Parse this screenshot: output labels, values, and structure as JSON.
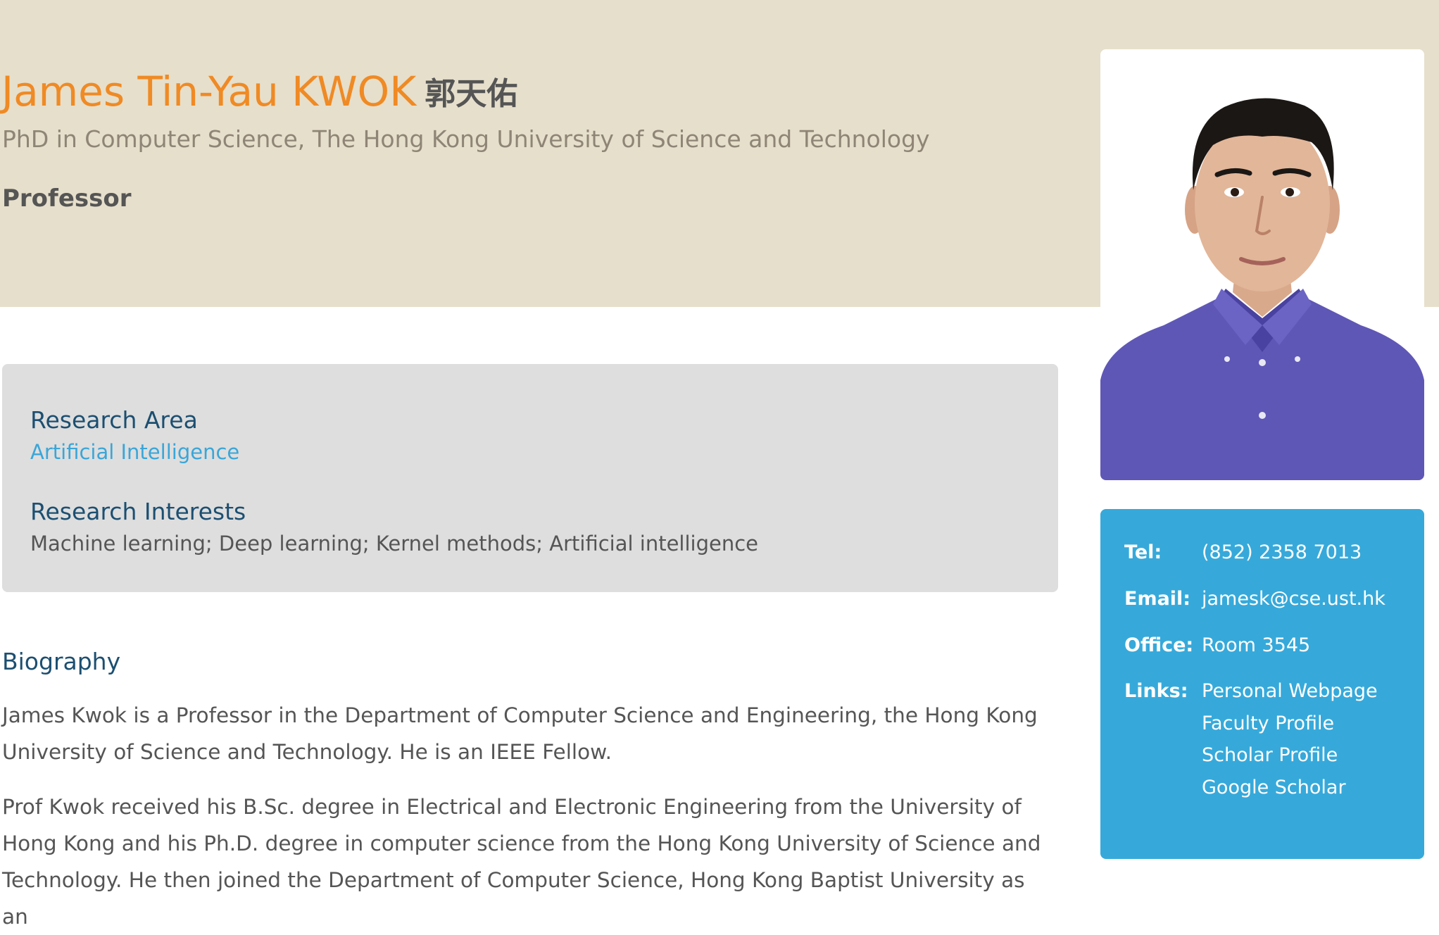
{
  "profile": {
    "name_en": "James Tin-Yau KWOK",
    "name_zh": "郭天佑",
    "degree": "PhD in Computer Science, The Hong Kong University of Science and Technology",
    "position": "Professor"
  },
  "research": {
    "area_heading": "Research Area",
    "area_value": "Artificial Intelligence",
    "interests_heading": "Research Interests",
    "interests_value": "Machine learning; Deep learning; Kernel methods; Artificial intelligence"
  },
  "biography": {
    "heading": "Biography",
    "paragraph1": "James Kwok is a Professor in the Department of Computer Science and Engineering, the Hong Kong University of Science and Technology. He is an IEEE Fellow.",
    "paragraph2": "Prof Kwok received his B.Sc. degree in Electrical and Electronic Engineering from the University of Hong Kong and his Ph.D. degree in computer science from the Hong Kong University of Science and Technology. He then joined the Department of Computer Science, Hong Kong Baptist University as an"
  },
  "contact": {
    "tel_label": "Tel:",
    "tel_value": "(852) 2358 7013",
    "email_label": "Email:",
    "email_value": "jamesk@cse.ust.hk",
    "office_label": "Office:",
    "office_value": "Room 3545",
    "links_label": "Links:",
    "links": [
      "Personal Webpage",
      "Faculty Profile",
      "Scholar Profile",
      "Google Scholar"
    ]
  },
  "colors": {
    "header_band": "#e6dfcb",
    "name_accent": "#f08a24",
    "heading_blue": "#1c4f71",
    "link_blue": "#3aa6d8",
    "contact_card": "#36a9da"
  }
}
